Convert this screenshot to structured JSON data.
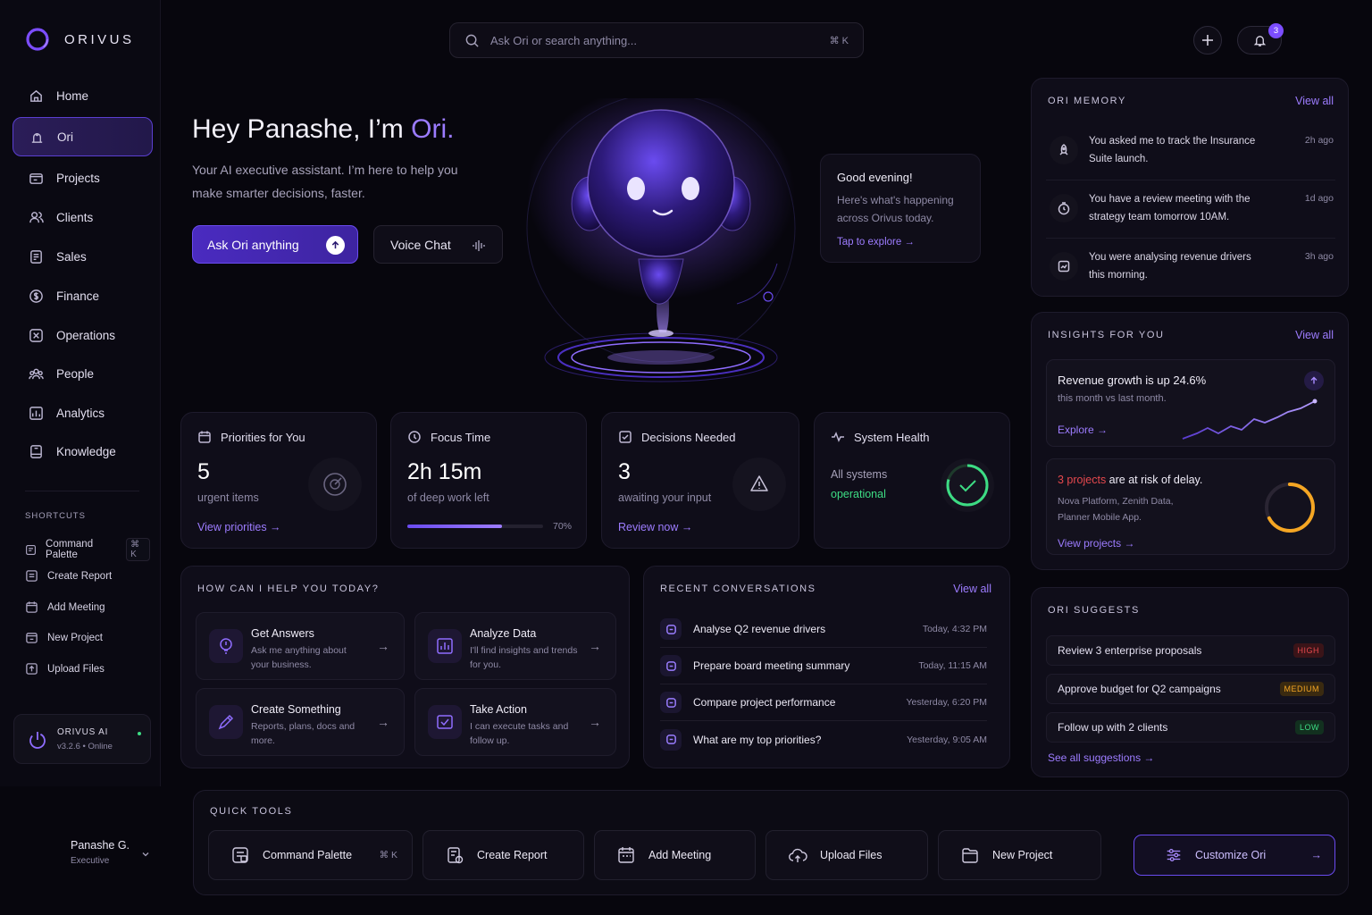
{
  "brand": {
    "name": "ORIVUS",
    "accent": "#7c4dff"
  },
  "search": {
    "placeholder": "Ask Ori or search anything...",
    "shortcut": "⌘ K"
  },
  "notifications": {
    "count": "3"
  },
  "nav": [
    {
      "label": "Home",
      "icon": "home-icon"
    },
    {
      "label": "Ori",
      "icon": "ori-icon",
      "active": true
    },
    {
      "label": "Projects",
      "icon": "folder-icon"
    },
    {
      "label": "Clients",
      "icon": "users-icon"
    },
    {
      "label": "Sales",
      "icon": "receipt-icon"
    },
    {
      "label": "Finance",
      "icon": "dollar-icon"
    },
    {
      "label": "Operations",
      "icon": "operations-icon"
    },
    {
      "label": "People",
      "icon": "people-icon"
    },
    {
      "label": "Analytics",
      "icon": "analytics-icon"
    },
    {
      "label": "Knowledge",
      "icon": "book-icon"
    }
  ],
  "shortcuts": {
    "heading": "SHORTCUTS",
    "items": [
      {
        "label": "Command Palette",
        "kbd": "⌘ K"
      },
      {
        "label": "Create Report"
      },
      {
        "label": "Add Meeting"
      },
      {
        "label": "New Project"
      },
      {
        "label": "Upload Files"
      }
    ]
  },
  "system": {
    "name": "ORIVUS AI",
    "version": "v3.2.6 • Online"
  },
  "user": {
    "name": "Panashe G.",
    "role": "Executive"
  },
  "hero": {
    "greeting": "Hey Panashe, I’m ",
    "name": "Ori.",
    "subtitle_1": "Your AI executive assistant. I’m here to help you",
    "subtitle_2": "make smarter decisions, faster.",
    "primary_button": "Ask Ori anything",
    "secondary_button": "Voice Chat"
  },
  "bubble": {
    "title": "Good evening!",
    "line_1": "Here's what's happening",
    "line_2": "across Orivus today.",
    "link": "Tap to explore →"
  },
  "stats": {
    "priorities": {
      "title": "Priorities for You",
      "value": "5",
      "sub": "urgent items",
      "link": "View priorities →"
    },
    "focus": {
      "title": "Focus Time",
      "value": "2h 15m",
      "sub": "of deep work left",
      "progress": 70,
      "progress_label": "70%"
    },
    "decisions": {
      "title": "Decisions Needed",
      "value": "3",
      "sub": "awaiting your input",
      "link": "Review now →"
    },
    "health": {
      "title": "System Health",
      "line_1": "All systems",
      "line_2": "operational",
      "status_color": "#3ddc84"
    }
  },
  "help": {
    "heading": "HOW CAN I HELP YOU TODAY?",
    "tiles": [
      {
        "title": "Get Answers",
        "desc": "Ask me anything about your business.",
        "icon": "bulb-icon"
      },
      {
        "title": "Analyze Data",
        "desc": "I'll find insights and trends for you.",
        "icon": "chart-icon"
      },
      {
        "title": "Create Something",
        "desc": "Reports, plans, docs and more.",
        "icon": "pen-icon"
      },
      {
        "title": "Take Action",
        "desc": "I can execute tasks and follow up.",
        "icon": "action-icon"
      }
    ]
  },
  "conversations": {
    "heading": "RECENT CONVERSATIONS",
    "view_all": "View all",
    "items": [
      {
        "title": "Analyse Q2 revenue drivers",
        "time": "Today, 4:32 PM"
      },
      {
        "title": "Prepare board meeting summary",
        "time": "Today, 11:15 AM"
      },
      {
        "title": "Compare project performance",
        "time": "Yesterday, 6:20 PM"
      },
      {
        "title": "What are my top priorities?",
        "time": "Yesterday, 9:05 AM"
      }
    ]
  },
  "memory": {
    "heading": "ORI MEMORY",
    "view_all": "View all",
    "items": [
      {
        "text": "You asked me to track the Insurance Suite launch.",
        "time": "2h ago",
        "icon": "rocket-icon"
      },
      {
        "text": "You have a review meeting with the strategy team tomorrow 10AM.",
        "time": "1d ago",
        "icon": "clock-icon"
      },
      {
        "text": "You were analysing revenue drivers this morning.",
        "time": "3h ago",
        "icon": "report-icon"
      }
    ]
  },
  "insights": {
    "heading": "INSIGHTS FOR YOU",
    "view_all": "View all",
    "revenue": {
      "title": "Revenue growth is up 24.6%",
      "sub": "this month vs last month.",
      "link": "Explore →"
    },
    "risk": {
      "count": "3 projects",
      "title_rest": " are at risk of delay.",
      "line_1": "Nova Platform, Zenith Data,",
      "line_2": "Planner Mobile App.",
      "link": "View projects →",
      "risk_color": "#f5a623"
    }
  },
  "suggests": {
    "heading": "ORI SUGGESTS",
    "items": [
      {
        "label": "Review 3 enterprise proposals",
        "badge": "HIGH",
        "color": "#e5484d"
      },
      {
        "label": "Approve budget for Q2 campaigns",
        "badge": "MEDIUM",
        "color": "#f5a623"
      },
      {
        "label": "Follow up with 2 clients",
        "badge": "LOW",
        "color": "#3ddc84"
      }
    ],
    "see_all": "See all suggestions →"
  },
  "quick_tools": {
    "heading": "QUICK TOOLS",
    "items": [
      {
        "label": "Command Palette",
        "kbd": "⌘ K"
      },
      {
        "label": "Create Report"
      },
      {
        "label": "Add Meeting"
      },
      {
        "label": "Upload Files"
      },
      {
        "label": "New Project"
      }
    ],
    "customize": "Customize Ori"
  }
}
